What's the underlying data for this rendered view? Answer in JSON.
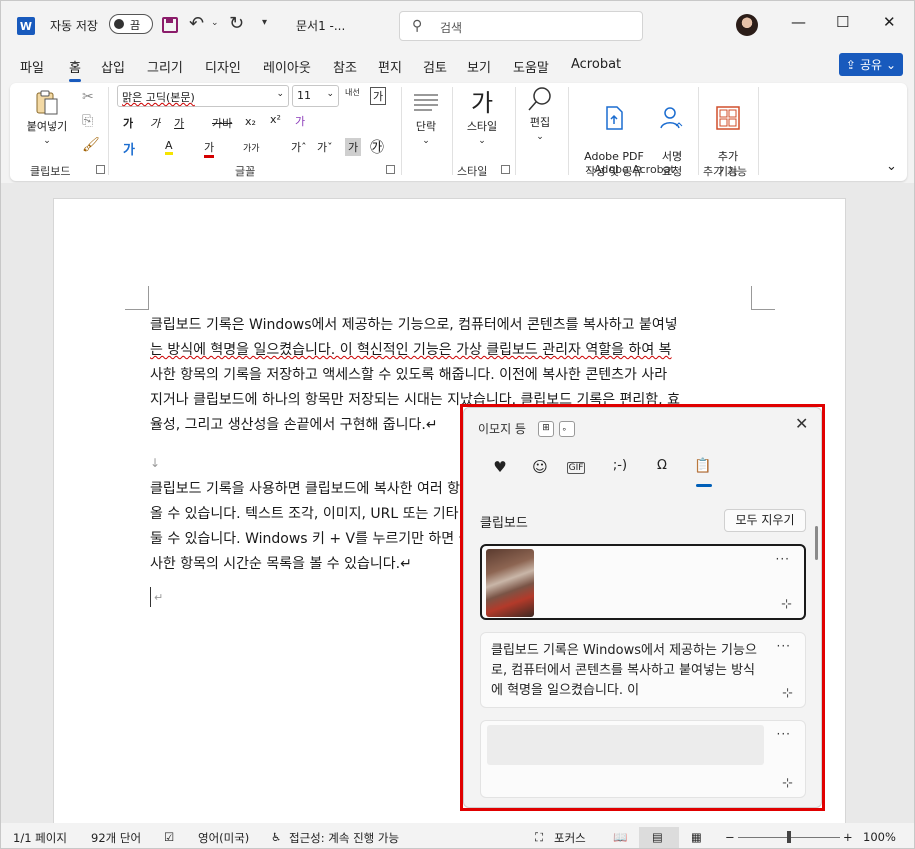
{
  "titlebar": {
    "app_logo": "W",
    "autosave_label": "자동 저장",
    "autosave_state": "끔",
    "doc_title": "문서1  -...",
    "search_placeholder": "검색",
    "minimize": "—",
    "maximize": "☐",
    "close": "✕"
  },
  "tabs": [
    "파일",
    "홈",
    "삽입",
    "그리기",
    "디자인",
    "레이아웃",
    "참조",
    "편지",
    "검토",
    "보기",
    "도움말",
    "Acrobat"
  ],
  "active_tab": "홈",
  "share_label": "공유",
  "ribbon": {
    "clipboard": {
      "paste": "붙여넣기",
      "label": "클립보드"
    },
    "font": {
      "font_name": "맑은 고딕(본문)",
      "font_size": "11",
      "phonetic": "내선",
      "clear_format": "가",
      "bold": "가",
      "italic": "가",
      "underline": "가",
      "strike": "가바",
      "sub": "x₂",
      "sup": "x²",
      "effects": "가",
      "highlight": "A",
      "color": "가",
      "case": "가가",
      "grow": "가ˆ",
      "shrink": "가ˇ",
      "shade": "가",
      "enclose": "㉮",
      "label": "글꼴"
    },
    "paragraph": {
      "label": "단락"
    },
    "style": {
      "label": "스타일",
      "group": "스타일"
    },
    "edit": {
      "label": "편집"
    },
    "acrobat": {
      "create": "Adobe PDF\n작성 및 공유",
      "sign": "서명\n요청",
      "group": "Adobe Acrobat"
    },
    "addins": {
      "label": "추가\n기능",
      "group": "추가 기능"
    }
  },
  "document": {
    "para1": [
      "클립보드 기록은 Windows에서 제공하는 기능으로, 컴퓨터에서 콘텐츠를 복사하고 붙여넣",
      "는 방식에 혁명을 일으켰습니다. 이 혁신적인 기능은 가상 클립보드 관리자 역할을 하여 복",
      "사한 항목의 기록을 저장하고 액세스할 수 있도록 해줍니다. 이전에 복사한 콘텐츠가 사라",
      "지거나 클립보드에 하나의 항목만 저장되는 시대는 지났습니다. 클립보드 기록은 편리함, 효",
      "율성, 그리고 생산성을 손끝에서 구현해 줍니다.↵"
    ],
    "para2": [
      "클립보드 기록을 사용하면 클립보드에 복사한 여러 항목을 저장하고 필요할 때 다시 불러",
      "올 수 있습니다. 텍스트 조각, 이미지, URL 또는 기타 유형의 콘텐츠 등 원하는 것을 보관해",
      "둘 수 있습니다. Windows 키 + V를 누르기만 하면 클립보드 기록 창이 열리고 최근에 복",
      "사한 항목의 시간순 목록을 볼 수 있습니다.↵"
    ],
    "empty_para_mark": "↓",
    "cursor_mark": "↵"
  },
  "statusbar": {
    "pages": "1/1 페이지",
    "words": "92개 단어",
    "language": "영어(미국)",
    "accessibility": "접근성: 계속 진행 가능",
    "focus": "포커스",
    "zoom": "100%",
    "zoom_level": 1.0
  },
  "clipboard_panel": {
    "title": "이모지 등",
    "key1": "⊞",
    "key2": "。",
    "categories": [
      "♥",
      "☺",
      "GIF",
      ";-)",
      "Ω",
      "📋"
    ],
    "section": "클립보드",
    "clear_all": "모두 지우기",
    "items": [
      {
        "type": "image"
      },
      {
        "type": "text",
        "text": "클립보드 기록은 Windows에서 제공하는 기능으로, 컴퓨터에서 콘텐츠를 복사하고 붙여넣는 방식에 혁명을 일으켰습니다. 이"
      },
      {
        "type": "loading"
      }
    ],
    "more": "···",
    "pin": "⊹"
  }
}
